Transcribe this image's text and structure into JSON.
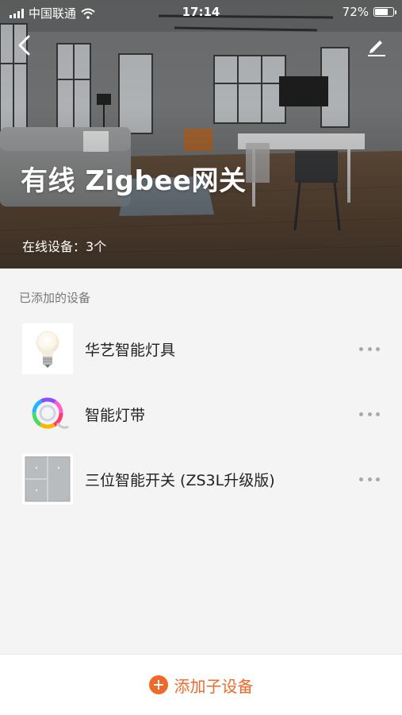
{
  "status_bar": {
    "carrier": "中国联通",
    "time": "17:14",
    "battery": "72%",
    "battery_level": 0.72
  },
  "header": {
    "title": "有线 Zigbee网关",
    "online_label": "在线设备：",
    "online_count": "3个",
    "back_icon": "chevron-left-icon",
    "edit_icon": "pencil-icon"
  },
  "section": {
    "label": "已添加的设备"
  },
  "devices": [
    {
      "name": "华艺智能灯具",
      "icon": "bulb-icon"
    },
    {
      "name": "智能灯带",
      "icon": "light-strip-icon"
    },
    {
      "name": "三位智能开关 (ZS3L升级版)",
      "icon": "wall-switch-icon"
    }
  ],
  "footer": {
    "add_label": "添加子设备",
    "accent": "#ef6a2a"
  }
}
